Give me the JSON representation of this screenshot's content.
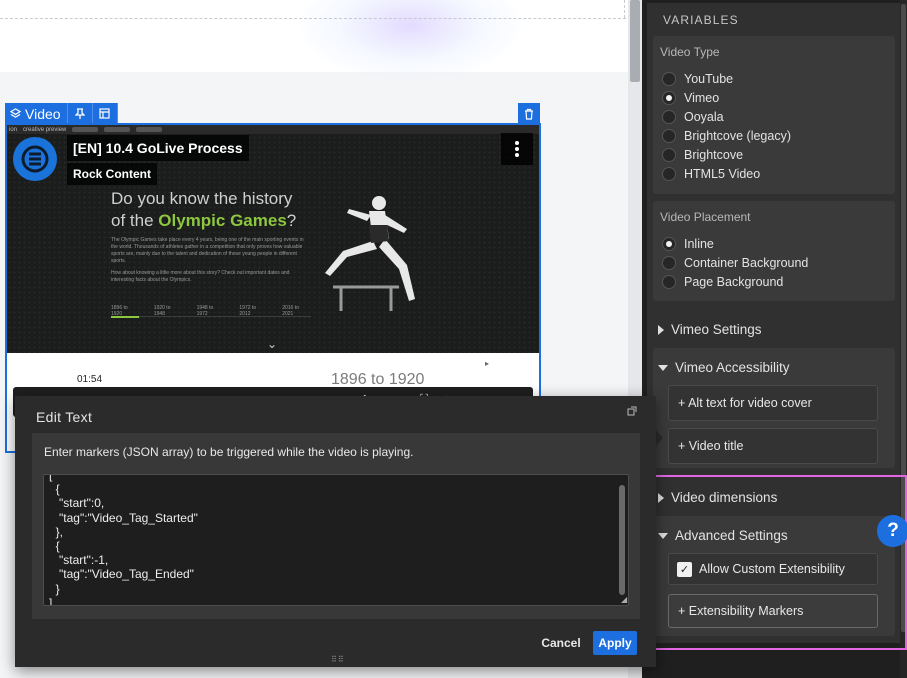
{
  "canvas": {
    "video_tag": {
      "label": "Video"
    },
    "video": {
      "title": "[EN] 10.4 GoLive Process",
      "channel": "Rock Content",
      "mini_bar": [
        "ion",
        "creative preview"
      ],
      "headline_line1": "Do you know the history",
      "headline_prefix": "of the ",
      "headline_highlight": "Olympic Games",
      "headline_suffix": "?",
      "paragraph1": "The Olympic Games take place every 4 years, being one of the main sporting events in the world. Thousands of athletes gather in a competition that only proves how valuable sports are, mainly due to the talent and dedication of those young people in different sports.",
      "paragraph2": "How about knowing a little more about this story? Check out important dates and interesting facts about the Olympics.",
      "timeline": [
        "1896 to 1920",
        "1920 to 1948",
        "1948 to 1972",
        "1972 to 2012",
        "2016 to 2021"
      ],
      "time": "01:54",
      "year_heading": "1896 to 1920"
    }
  },
  "dialog": {
    "title": "Edit Text",
    "instruction": "Enter markers (JSON array) to be triggered while the video is playing.",
    "markers_text": "[\n  {\n   \"start\":0,\n   \"tag\":\"Video_Tag_Started\"\n  },\n  {\n   \"start\":-1,\n   \"tag\":\"Video_Tag_Ended\"\n  }\n]",
    "cancel_label": "Cancel",
    "apply_label": "Apply"
  },
  "panel": {
    "heading": "VARIABLES",
    "video_type": {
      "title": "Video Type",
      "options": [
        "YouTube",
        "Vimeo",
        "Ooyala",
        "Brightcove (legacy)",
        "Brightcove",
        "HTML5 Video"
      ],
      "selected": "Vimeo"
    },
    "video_placement": {
      "title": "Video Placement",
      "options": [
        "Inline",
        "Container Background",
        "Page Background"
      ],
      "selected": "Inline"
    },
    "vimeo_settings": "Vimeo Settings",
    "vimeo_accessibility": "Vimeo Accessibility",
    "alt_text_button": "+ Alt text for video cover",
    "video_title_button": "+ Video title",
    "video_dimensions": "Video dimensions",
    "advanced_settings": "Advanced Settings",
    "allow_custom": "Allow Custom Extensibility",
    "allow_custom_checked": true,
    "extensibility_markers": "+ Extensibility Markers",
    "help": "?"
  },
  "colors": {
    "accent": "#1d6fe0",
    "highlight_outline": "#e067e0",
    "olympic_green": "#8dc63f"
  }
}
